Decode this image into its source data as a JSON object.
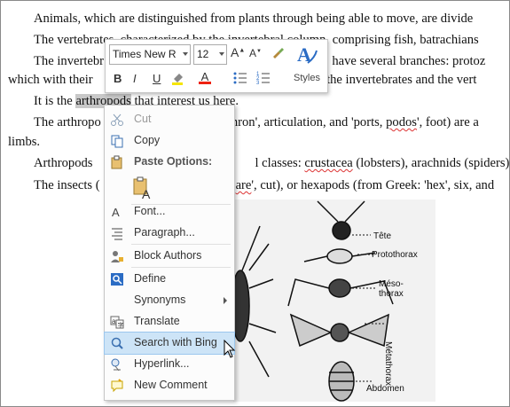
{
  "document": {
    "lines": [
      {
        "pre": "Animals, which are distinguished from plants through being able to move, are divide"
      },
      {
        "pre": "The vertebrates, characterized by the ",
        "sq": "invertebral",
        "post": " column, comprising fish, batrachians"
      },
      {
        "pre": "The invertebr",
        "post": ", have several branches: protoz"
      },
      {
        "pre": "which with their",
        "post": "en the invertebrates and the vert"
      },
      {
        "pre": "It is the ",
        "sel": "arthropods",
        "post": " that interest us here."
      },
      {
        "pre": "The arthropo",
        "post": "thron', articulation, and 'ports, ",
        "sq": "podos",
        "post2": "', foot) are a"
      },
      {
        "pre": "limbs."
      },
      {
        "pre": "Arthropods",
        "post": "l classes: ",
        "sq": "crustacea",
        "post2": " (lobsters), arachnids (spiders),"
      },
      {
        "pre": "The insects (",
        "sq": "are",
        "post": "', cut), or hexapods (from Greek: 'hex', six, and"
      }
    ]
  },
  "mini_toolbar": {
    "font_name": "Times New Roi",
    "font_size": "12",
    "styles_label": "Styles"
  },
  "context_menu": {
    "items": [
      {
        "label": "Cut",
        "icon": "scissors-icon",
        "disabled": true
      },
      {
        "label": "Copy",
        "icon": "copy-icon",
        "disabled": false
      },
      {
        "label": "Paste Options:",
        "icon": "clipboard-icon",
        "header": true
      },
      {
        "label": "Font...",
        "icon": "font-icon"
      },
      {
        "label": "Paragraph...",
        "icon": "paragraph-icon"
      },
      {
        "label": "Block Authors",
        "icon": "block-authors-icon"
      },
      {
        "label": "Define",
        "icon": "define-icon"
      },
      {
        "label": "Synonyms",
        "icon": "none",
        "submenu": true
      },
      {
        "label": "Translate",
        "icon": "translate-icon"
      },
      {
        "label": "Search with Bing",
        "icon": "search-icon",
        "highlighted": true
      },
      {
        "label": "Hyperlink...",
        "icon": "hyperlink-icon"
      },
      {
        "label": "New Comment",
        "icon": "new-comment-icon"
      }
    ]
  },
  "figure": {
    "labels": [
      "Tête",
      "Protothorax",
      "Méso-\nthorax",
      "Métathorax",
      "Abdomen"
    ]
  }
}
